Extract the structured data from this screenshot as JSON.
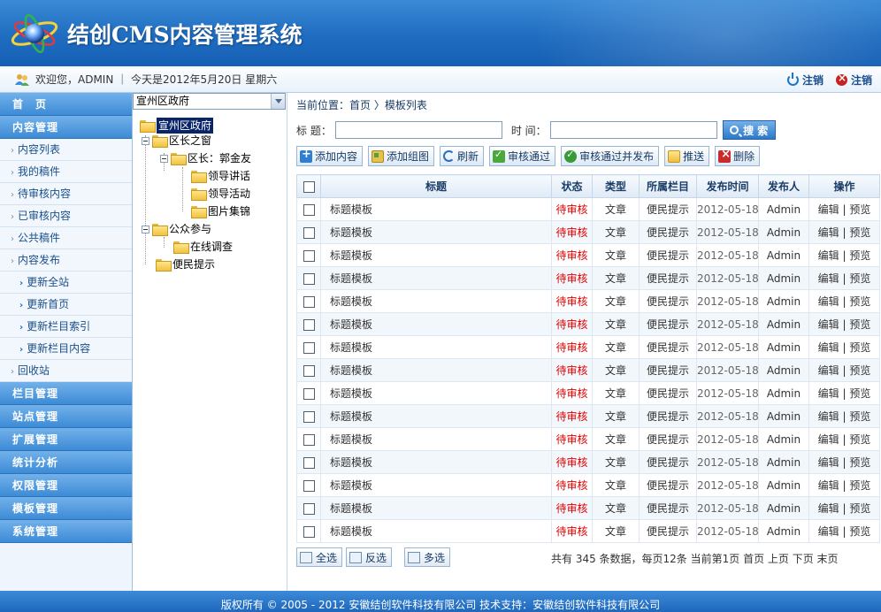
{
  "header": {
    "title": "结创CMS内容管理系统"
  },
  "userbar": {
    "welcome": "欢迎您，ADMIN ｜ 今天是2012年5月20日  星期六",
    "logout1": "注销",
    "logout2": "注销"
  },
  "nav": {
    "home": "首　页",
    "content_mgmt": "内容管理",
    "sub": [
      "内容列表",
      "我的稿件",
      "待审核内容",
      "已审核内容",
      "公共稿件",
      "内容发布"
    ],
    "publish_sub": [
      "更新全站",
      "更新首页",
      "更新栏目索引",
      "更新栏目内容"
    ],
    "recycle": "回收站",
    "sections": [
      "栏目管理",
      "站点管理",
      "扩展管理",
      "统计分析",
      "权限管理",
      "模板管理",
      "系统管理"
    ]
  },
  "tree": {
    "select_value": "宣州区政府",
    "root": "宣州区政府",
    "n1": "区长之窗",
    "n1a": "区长：郭金友",
    "n1a1": "领导讲话",
    "n1a2": "领导活动",
    "n1a3": "图片集锦",
    "n2": "公众参与",
    "n2a": "在线调查",
    "n3": "便民提示"
  },
  "main": {
    "breadcrumb": "当前位置：首页  〉模板列表",
    "title_label": "标 题：",
    "time_label": "时 间：",
    "search_btn": "搜 索",
    "toolbar": [
      "添加内容",
      "添加组图",
      "刷新",
      "审核通过",
      "审核通过并发布",
      "推送",
      "删除"
    ],
    "columns": [
      "标题",
      "状态",
      "类型",
      "所属栏目",
      "发布时间",
      "发布人",
      "操作"
    ],
    "rows": [
      {
        "title": "标题模板",
        "status": "待审核",
        "type": "文章",
        "column": "便民提示",
        "date": "2012-05-18",
        "author": "Admin",
        "edit": "编辑",
        "preview": "预览"
      },
      {
        "title": "标题模板",
        "status": "待审核",
        "type": "文章",
        "column": "便民提示",
        "date": "2012-05-18",
        "author": "Admin",
        "edit": "编辑",
        "preview": "预览"
      },
      {
        "title": "标题模板",
        "status": "待审核",
        "type": "文章",
        "column": "便民提示",
        "date": "2012-05-18",
        "author": "Admin",
        "edit": "编辑",
        "preview": "预览"
      },
      {
        "title": "标题模板",
        "status": "待审核",
        "type": "文章",
        "column": "便民提示",
        "date": "2012-05-18",
        "author": "Admin",
        "edit": "编辑",
        "preview": "预览"
      },
      {
        "title": "标题模板",
        "status": "待审核",
        "type": "文章",
        "column": "便民提示",
        "date": "2012-05-18",
        "author": "Admin",
        "edit": "编辑",
        "preview": "预览"
      },
      {
        "title": "标题模板",
        "status": "待审核",
        "type": "文章",
        "column": "便民提示",
        "date": "2012-05-18",
        "author": "Admin",
        "edit": "编辑",
        "preview": "预览"
      },
      {
        "title": "标题模板",
        "status": "待审核",
        "type": "文章",
        "column": "便民提示",
        "date": "2012-05-18",
        "author": "Admin",
        "edit": "编辑",
        "preview": "预览"
      },
      {
        "title": "标题模板",
        "status": "待审核",
        "type": "文章",
        "column": "便民提示",
        "date": "2012-05-18",
        "author": "Admin",
        "edit": "编辑",
        "preview": "预览"
      },
      {
        "title": "标题模板",
        "status": "待审核",
        "type": "文章",
        "column": "便民提示",
        "date": "2012-05-18",
        "author": "Admin",
        "edit": "编辑",
        "preview": "预览"
      },
      {
        "title": "标题模板",
        "status": "待审核",
        "type": "文章",
        "column": "便民提示",
        "date": "2012-05-18",
        "author": "Admin",
        "edit": "编辑",
        "preview": "预览"
      },
      {
        "title": "标题模板",
        "status": "待审核",
        "type": "文章",
        "column": "便民提示",
        "date": "2012-05-18",
        "author": "Admin",
        "edit": "编辑",
        "preview": "预览"
      },
      {
        "title": "标题模板",
        "status": "待审核",
        "type": "文章",
        "column": "便民提示",
        "date": "2012-05-18",
        "author": "Admin",
        "edit": "编辑",
        "preview": "预览"
      },
      {
        "title": "标题模板",
        "status": "待审核",
        "type": "文章",
        "column": "便民提示",
        "date": "2012-05-18",
        "author": "Admin",
        "edit": "编辑",
        "preview": "预览"
      },
      {
        "title": "标题模板",
        "status": "待审核",
        "type": "文章",
        "column": "便民提示",
        "date": "2012-05-18",
        "author": "Admin",
        "edit": "编辑",
        "preview": "预览"
      },
      {
        "title": "标题模板",
        "status": "待审核",
        "type": "文章",
        "column": "便民提示",
        "date": "2012-05-18",
        "author": "Admin",
        "edit": "编辑",
        "preview": "预览"
      }
    ],
    "bottom_buttons": [
      "全选",
      "反选",
      "多选"
    ],
    "pager": "共有 345 条数据，每页12条 当前第1页 首页 上页 下页 末页"
  },
  "footer": {
    "text": "版权所有 © 2005 - 2012 安徽结创软件科技有限公司  技术支持：安徽结创软件科技有限公司"
  },
  "colors": {
    "brand": "#1f6cc0",
    "status_pending": "#e00000"
  }
}
